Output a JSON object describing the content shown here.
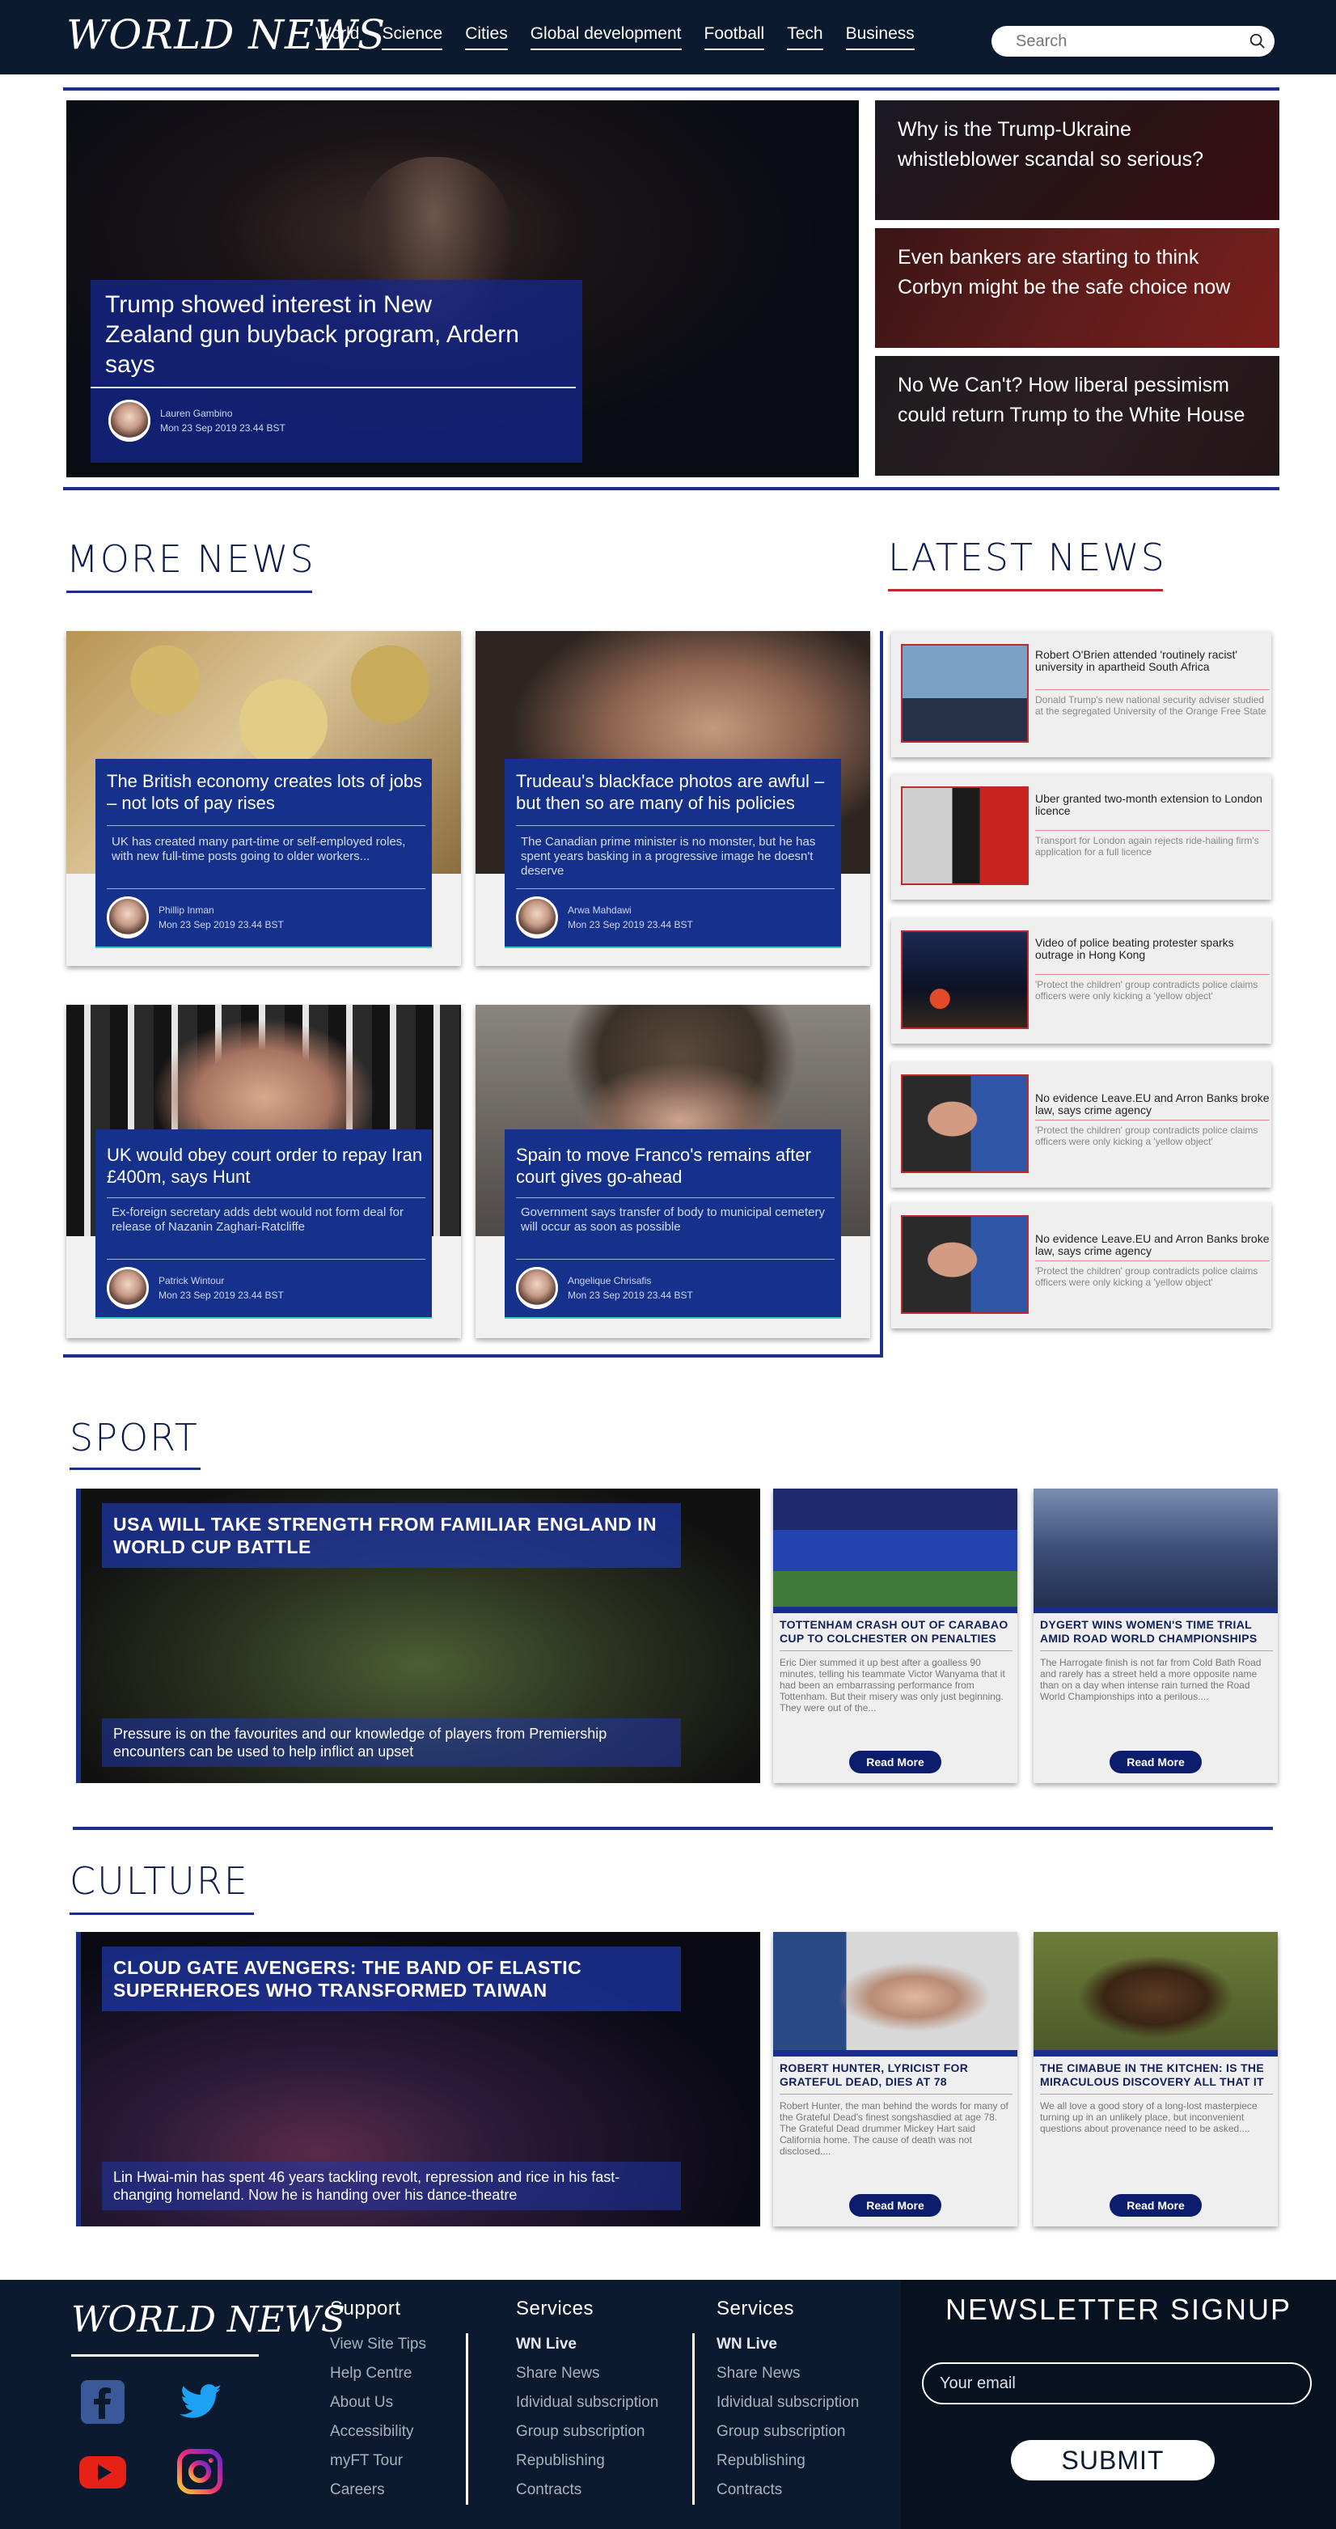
{
  "header": {
    "logo": "WORLD NEWS",
    "nav": [
      "World",
      "Science",
      "Cities",
      "Global development",
      "Football",
      "Tech",
      "Business"
    ],
    "search_placeholder": "Search"
  },
  "hero": {
    "title": "Trump showed interest in New Zealand gun buyback program, Ardern says",
    "author": "Lauren Gambino",
    "date": "Mon 23 Sep 2019 23.44 BST"
  },
  "side_stories": [
    {
      "title": "Why is the Trump-Ukraine whistleblower scandal so serious?"
    },
    {
      "title": "Even bankers are starting to think Corbyn might be the safe choice now"
    },
    {
      "title": "No We Can't? How liberal pessimism could return Trump to the White House"
    }
  ],
  "more_news": {
    "heading": "MORE NEWS",
    "cards": [
      {
        "title": "The British economy creates lots of jobs – not lots of pay rises",
        "desc": "UK has created many part-time or self-employed roles, with new full-time posts going to older workers...",
        "author": "Phillip Inman",
        "date": "Mon 23 Sep 2019 23.44 BST"
      },
      {
        "title": "Trudeau's blackface photos are awful – but then so are many of his policies",
        "desc": "The Canadian prime minister is no monster, but he has spent years basking in a progressive image he doesn't deserve",
        "author": "Arwa Mahdawi",
        "date": "Mon 23 Sep 2019 23.44 BST"
      },
      {
        "title": "UK would obey court order to repay Iran £400m, says Hunt",
        "desc": "Ex-foreign secretary adds debt would not form deal for release of Nazanin Zaghari-Ratcliffe",
        "author": "Patrick Wintour",
        "date": "Mon 23 Sep 2019 23.44 BST"
      },
      {
        "title": "Spain to move Franco's remains after court gives go-ahead",
        "desc": "Government says transfer of body to municipal cemetery will occur as soon as possible",
        "author": "Angelique Chrisafis",
        "date": "Mon 23 Sep 2019 23.44 BST"
      }
    ]
  },
  "latest_news": {
    "heading": "LATEST NEWS",
    "items": [
      {
        "title": "Robert O'Brien attended 'routinely racist' university in apartheid South Africa",
        "desc": "Donald Trump's new national security adviser studied at the segregated University of the Orange Free State"
      },
      {
        "title": "Uber granted two-month extension to London licence",
        "desc": "Transport for London again rejects ride-hailing firm's application for a full licence"
      },
      {
        "title": "Video of police beating protester sparks outrage in Hong Kong",
        "desc": "'Protect the children' group contradicts police claims officers were only kicking a 'yellow object'"
      },
      {
        "title": "No evidence Leave.EU and Arron Banks broke law, says crime agency",
        "desc": "'Protect the children' group contradicts police claims officers were only kicking a 'yellow object'"
      },
      {
        "title": "No evidence Leave.EU and Arron Banks broke law, says crime agency",
        "desc": "'Protect the children' group contradicts police claims officers were only kicking a 'yellow object'"
      }
    ]
  },
  "sport": {
    "heading": "SPORT",
    "feature": {
      "title": "USA WILL TAKE STRENGTH FROM FAMILIAR ENGLAND IN WORLD CUP BATTLE",
      "desc": "Pressure is on the favourites and our knowledge of players from Premiership encounters can be used to help inflict an upset"
    },
    "cards": [
      {
        "title": "TOTTENHAM CRASH OUT OF CARABAO CUP TO COLCHESTER ON PENALTIES",
        "desc": "Eric Dier summed it up best after a goalless 90 minutes, telling his teammate Victor Wanyama that it had been an embarrassing performance from Tottenham. But their misery was only just beginning. They were out of the...",
        "button": "Read More"
      },
      {
        "title": "DYGERT WINS WOMEN'S TIME TRIAL AMID ROAD WORLD CHAMPIONSHIPS",
        "desc": "The Harrogate finish is not far from Cold Bath Road and rarely has a street held a more opposite name than on a day when intense rain turned the Road World Championships into a perilous....",
        "button": "Read More"
      }
    ]
  },
  "culture": {
    "heading": "CULTURE",
    "feature": {
      "title": "CLOUD GATE AVENGERS: THE BAND OF ELASTIC SUPERHEROES WHO TRANSFORMED TAIWAN",
      "desc": "Lin Hwai-min has spent 46 years tackling revolt, repression and rice in his fast-changing homeland. Now he is handing over his dance-theatre"
    },
    "cards": [
      {
        "title": "ROBERT HUNTER, LYRICIST FOR GRATEFUL DEAD, DIES AT 78",
        "desc": "Robert Hunter, the man behind the words for many of the Grateful Dead's finest songshasdied at age 78.\nThe Grateful Dead drummer Mickey Hart said California home. The cause of death was not disclosed....",
        "button": "Read More"
      },
      {
        "title": "THE CIMABUE IN THE KITCHEN: IS THE MIRACULOUS DISCOVERY ALL THAT IT",
        "desc": "We all love a good story of a long-lost masterpiece turning up in an unlikely place, but inconvenient questions about provenance need to be asked....",
        "button": "Read More"
      }
    ]
  },
  "footer": {
    "logo": "WORLD NEWS",
    "support": {
      "heading": "Support",
      "items": [
        "View Site Tips",
        "Help Centre",
        "About Us",
        "Accessibility",
        "myFT Tour",
        "Careers"
      ]
    },
    "services1": {
      "heading": "Services",
      "items": [
        "WN Live",
        "Share News",
        "Idividual subscription",
        "Group subscription",
        "Republishing",
        "Contracts"
      ]
    },
    "services2": {
      "heading": "Services",
      "items": [
        "WN Live",
        "Share News",
        "Idividual subscription",
        "Group subscription",
        "Republishing",
        "Contracts"
      ]
    },
    "newsletter": {
      "heading": "NEWSLETTER SIGNUP",
      "placeholder": "Your email",
      "button": "SUBMIT"
    },
    "social_icons": [
      "facebook-icon",
      "twitter-icon",
      "youtube-icon",
      "instagram-icon"
    ]
  },
  "colors": {
    "navy": "#0b1a2e",
    "accent_blue": "#1a2e8a",
    "card_blue": "#16318c",
    "latest_red": "#c0282d"
  }
}
